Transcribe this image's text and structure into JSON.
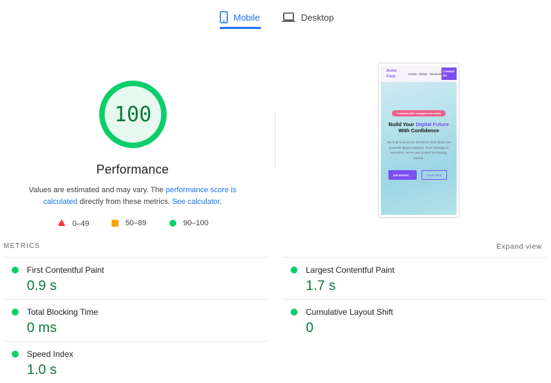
{
  "tabs": [
    {
      "label": "Mobile",
      "icon": "smartphone-icon",
      "active": true
    },
    {
      "label": "Desktop",
      "icon": "laptop-icon",
      "active": false
    }
  ],
  "performance": {
    "score": "100",
    "score_fraction": 1.0,
    "title": "Performance",
    "description_part1": "Values are estimated and may vary. The ",
    "link_score": "performance score is calculated",
    "description_part2": " directly from these metrics. ",
    "link_calculator": "See calculator",
    "description_part3": "."
  },
  "legend": [
    {
      "range": "0–49",
      "shape": "triangle",
      "color": "#ff3333"
    },
    {
      "range": "50–89",
      "shape": "square",
      "color": "#ffa400"
    },
    {
      "range": "90–100",
      "shape": "circle",
      "color": "#0cce6b"
    }
  ],
  "screenshot": {
    "brand": "Acme Corp",
    "nav": [
      "Home",
      "About",
      "Services"
    ],
    "contact": "Contact Us",
    "badge": "Trusted by 500+ companies worldwide",
    "heading_pre": "Build Your ",
    "heading_accent": "Digital Future",
    "heading_post": "With Confidence",
    "paragraph": "We help businesses transform their ideas into powerful digital solutions. From strategy to execution, we're your trusted technology partner.",
    "primary_cta": "Get started →",
    "secondary_cta": "Learn more"
  },
  "metrics": {
    "label": "METRICS",
    "expand": "Expand view",
    "items": [
      {
        "name": "First Contentful Paint",
        "value": "0.9 s"
      },
      {
        "name": "Largest Contentful Paint",
        "value": "1.7 s"
      },
      {
        "name": "Total Blocking Time",
        "value": "0 ms"
      },
      {
        "name": "Cumulative Layout Shift",
        "value": "0"
      },
      {
        "name": "Speed Index",
        "value": "1.0 s"
      }
    ]
  },
  "colors": {
    "accent": "#1a73e8",
    "pass": "#0cce6b",
    "pass_text": "#0c7a3d",
    "brand_purple": "#7b4ff0"
  }
}
